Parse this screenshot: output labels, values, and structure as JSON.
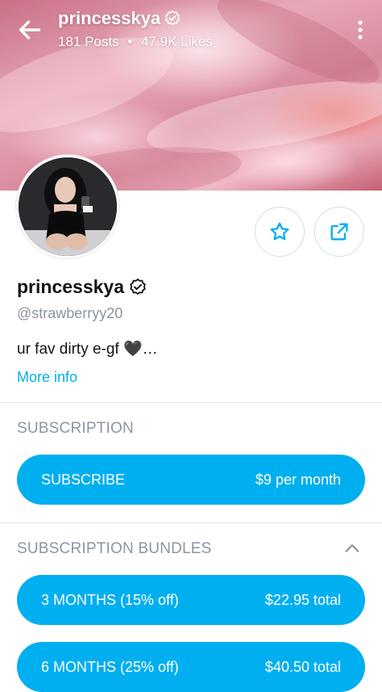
{
  "header": {
    "username": "princesskya",
    "posts": "181 Posts",
    "separator": "•",
    "likes": "47.9K Likes"
  },
  "profile": {
    "display_name": "princesskya",
    "handle": "@strawberryy20",
    "bio": "ur fav dirty e-gf 🖤…",
    "more_info": "More info"
  },
  "subscription": {
    "title": "SUBSCRIPTION",
    "button_label": "SUBSCRIBE",
    "button_price": "$9 per month"
  },
  "bundles": {
    "title": "SUBSCRIPTION BUNDLES",
    "items": [
      {
        "label": "3 MONTHS (15% off)",
        "price": "$22.95 total"
      },
      {
        "label": "6 MONTHS (25% off)",
        "price": "$40.50 total"
      }
    ]
  },
  "icons": [
    "back-arrow-icon",
    "verified-icon",
    "more-vertical-icon",
    "star-icon",
    "share-icon",
    "chevron-up-icon"
  ],
  "colors": {
    "accent": "#00aff0",
    "muted": "#8a96a3",
    "text": "#141414"
  }
}
